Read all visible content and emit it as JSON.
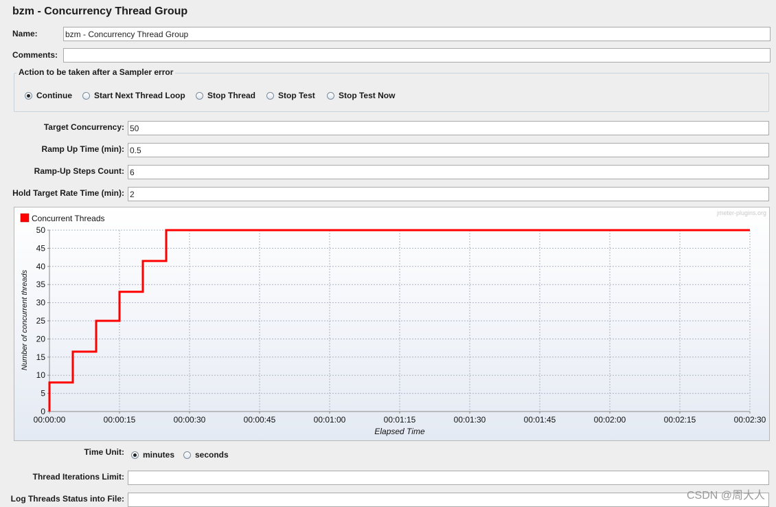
{
  "title": "bzm - Concurrency Thread Group",
  "name_field": {
    "label": "Name:",
    "value": "bzm - Concurrency Thread Group"
  },
  "comments_field": {
    "label": "Comments:",
    "value": ""
  },
  "sampler_error": {
    "title": "Action to be taken after a Sampler error",
    "options": [
      {
        "label": "Continue",
        "selected": true
      },
      {
        "label": "Start Next Thread Loop",
        "selected": false
      },
      {
        "label": "Stop Thread",
        "selected": false
      },
      {
        "label": "Stop Test",
        "selected": false
      },
      {
        "label": "Stop Test Now",
        "selected": false
      }
    ]
  },
  "params": {
    "target_concurrency": {
      "label": "Target Concurrency:",
      "value": "50"
    },
    "ramp_up_time": {
      "label": "Ramp Up Time (min):",
      "value": "0.5"
    },
    "ramp_up_steps": {
      "label": "Ramp-Up Steps Count:",
      "value": "6"
    },
    "hold_time": {
      "label": "Hold Target Rate Time (min):",
      "value": "2"
    }
  },
  "time_unit": {
    "label": "Time Unit:",
    "options": [
      {
        "label": "minutes",
        "selected": true
      },
      {
        "label": "seconds",
        "selected": false
      }
    ]
  },
  "iterations_limit": {
    "label": "Thread Iterations Limit:",
    "value": ""
  },
  "log_threads": {
    "label": "Log Threads Status into File:",
    "value": ""
  },
  "watermark": "CSDN @周大人",
  "chart_data": {
    "type": "line",
    "credit": "jmeter-plugins.org",
    "xlabel": "Elapsed Time",
    "ylabel": "Number of concurrent threads",
    "x_ticks": [
      "00:00:00",
      "00:00:15",
      "00:00:30",
      "00:00:45",
      "00:01:00",
      "00:01:15",
      "00:01:30",
      "00:01:45",
      "00:02:00",
      "00:02:15",
      "00:02:30"
    ],
    "y_ticks": [
      0,
      5,
      10,
      15,
      20,
      25,
      30,
      35,
      40,
      45,
      50
    ],
    "xlim_seconds": [
      0,
      150
    ],
    "ylim": [
      0,
      50
    ],
    "grid": true,
    "legend_position": "top-left",
    "series": [
      {
        "name": "Concurrent Threads",
        "color": "#ff0000",
        "x_seconds": [
          0,
          0,
          5,
          5,
          10,
          10,
          15,
          15,
          20,
          20,
          25,
          25,
          150
        ],
        "values": [
          0,
          8,
          8,
          16.5,
          16.5,
          25,
          25,
          33,
          33,
          41.5,
          41.5,
          50,
          50
        ]
      }
    ]
  }
}
